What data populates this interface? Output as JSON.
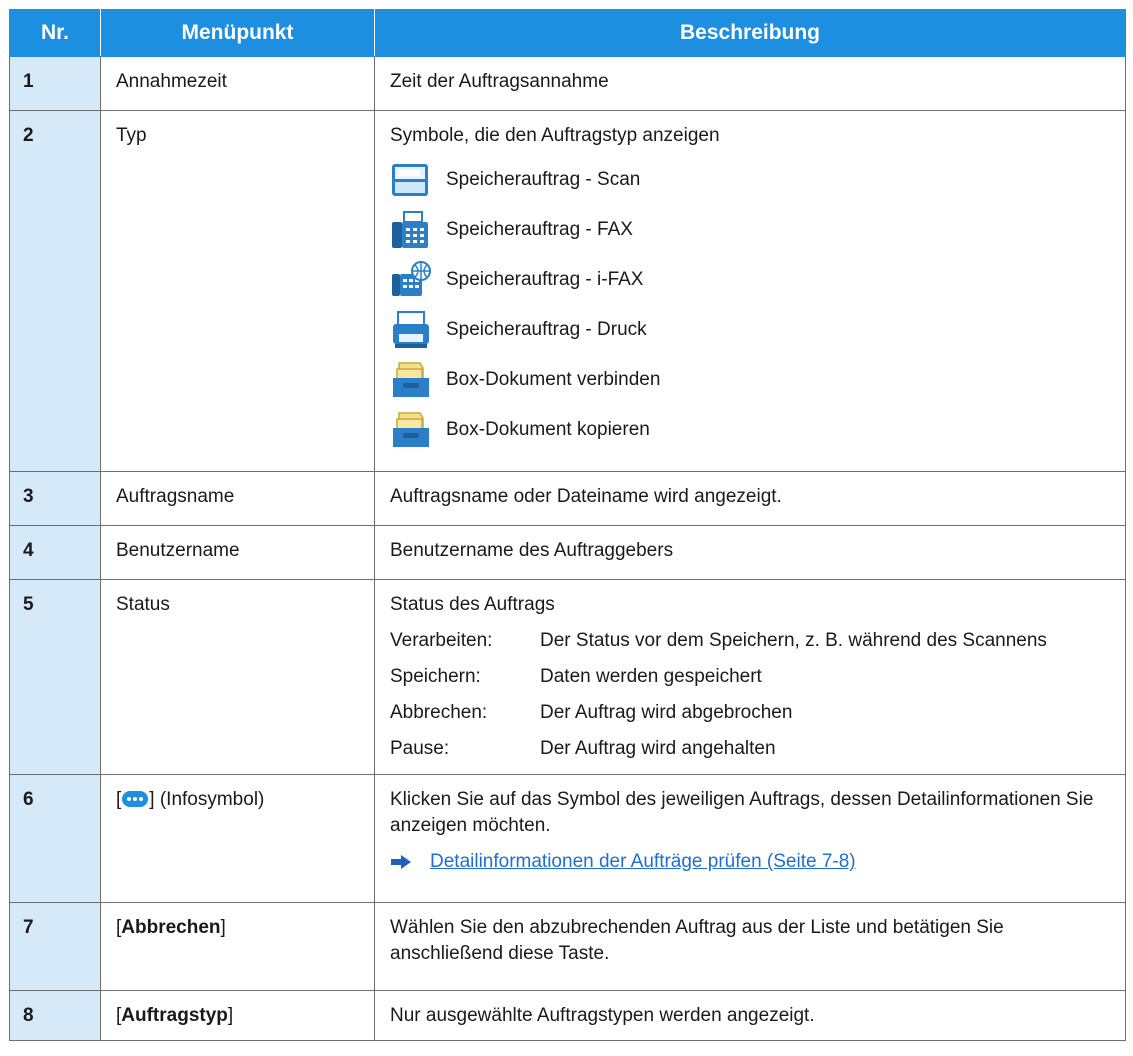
{
  "header": {
    "nr": "Nr.",
    "item": "Menüpunkt",
    "desc": "Beschreibung"
  },
  "rows": [
    {
      "nr": "1",
      "item": "Annahmezeit",
      "desc": "Zeit der Auftragsannahme"
    },
    {
      "nr": "2",
      "item": "Typ",
      "desc": "Symbole, die den Auftragstyp anzeigen",
      "types": [
        {
          "icon": "scanner-icon",
          "label": "Speicherauftrag - Scan"
        },
        {
          "icon": "fax-icon",
          "label": "Speicherauftrag - FAX"
        },
        {
          "icon": "ifax-icon",
          "label": "Speicherauftrag - i-FAX"
        },
        {
          "icon": "printer-icon",
          "label": "Speicherauftrag - Druck"
        },
        {
          "icon": "document-box-icon",
          "label": "Box-Dokument verbinden"
        },
        {
          "icon": "document-box-icon",
          "label": "Box-Dokument kopieren"
        }
      ]
    },
    {
      "nr": "3",
      "item": "Auftragsname",
      "desc": "Auftragsname oder Dateiname wird angezeigt."
    },
    {
      "nr": "4",
      "item": "Benutzername",
      "desc": "Benutzername des Auftraggebers"
    },
    {
      "nr": "5",
      "item": "Status",
      "desc": "Status des Auftrags",
      "statuses": [
        {
          "label": "Verarbeiten:",
          "text": "Der Status vor dem Speichern, z. B. während des Scannens"
        },
        {
          "label": "Speichern:",
          "text": "Daten werden gespeichert"
        },
        {
          "label": "Abbrechen:",
          "text": "Der Auftrag wird abgebrochen"
        },
        {
          "label": "Pause:",
          "text": "Der Auftrag wird angehalten"
        }
      ]
    },
    {
      "nr": "6",
      "item_open": "[",
      "item_close": "] (Infosymbol)",
      "item_icon": "info-icon",
      "desc": "Klicken Sie auf das Symbol des jeweiligen Auftrags, dessen Detailinformationen Sie anzeigen möchten.",
      "link": "Detailinformationen der Aufträge prüfen (Seite 7-8)"
    },
    {
      "nr": "7",
      "item_open": "[",
      "item_bold": "Abbrechen",
      "item_close": "]",
      "desc": "Wählen Sie den abzubrechenden Auftrag aus der Liste und betätigen Sie anschließend diese Taste."
    },
    {
      "nr": "8",
      "item_open": "[",
      "item_bold": "Auftragstyp",
      "item_close": "]",
      "desc": "Nur ausgewählte Auftragstypen werden angezeigt."
    }
  ],
  "colors": {
    "header_bg": "#1c8fe0",
    "nr_bg": "#d6e9f9",
    "link": "#1f6fd2"
  }
}
